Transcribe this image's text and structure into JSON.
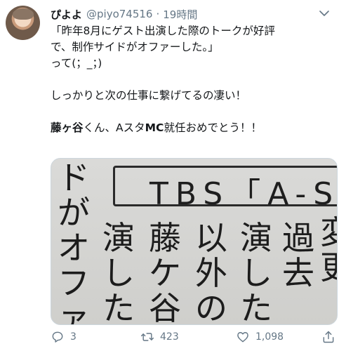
{
  "tweet": {
    "display_name": "ぴよよ",
    "handle": "@piyo74516",
    "separator": "·",
    "time": "19時間",
    "lines": [
      "「昨年8月にゲスト出演した際のトークが好評",
      "で、制作サイドがオファーした。」",
      "って(；_；)"
    ],
    "line4": "しっかりと次の仕事に繋げてるの凄い！",
    "line5_bold1": "藤ヶ谷",
    "line5_mid": "くん、Aスタ",
    "line5_bold2": "MC",
    "line5_end": "就任おめでとう！！"
  },
  "media": {
    "header_text": "TBS「A-S",
    "columns": [
      [
        "ド",
        "が",
        "オ",
        "フ",
        "ァ"
      ],
      [
        "演",
        "し",
        "た",
        "",
        ""
      ],
      [
        "藤",
        "ケ",
        "谷",
        "",
        ""
      ],
      [
        "以",
        "外",
        "の",
        "",
        ""
      ],
      [
        "演",
        "し",
        "た",
        "",
        ""
      ],
      [
        "",
        "過",
        "去",
        "",
        ""
      ],
      [
        "変",
        "更",
        "",
        "",
        ""
      ]
    ]
  },
  "actions": {
    "reply_count": "3",
    "retweet_count": "423",
    "like_count": "1,098"
  },
  "icons": [
    "chevron-down-icon",
    "reply-icon",
    "retweet-icon",
    "like-icon",
    "share-icon"
  ]
}
